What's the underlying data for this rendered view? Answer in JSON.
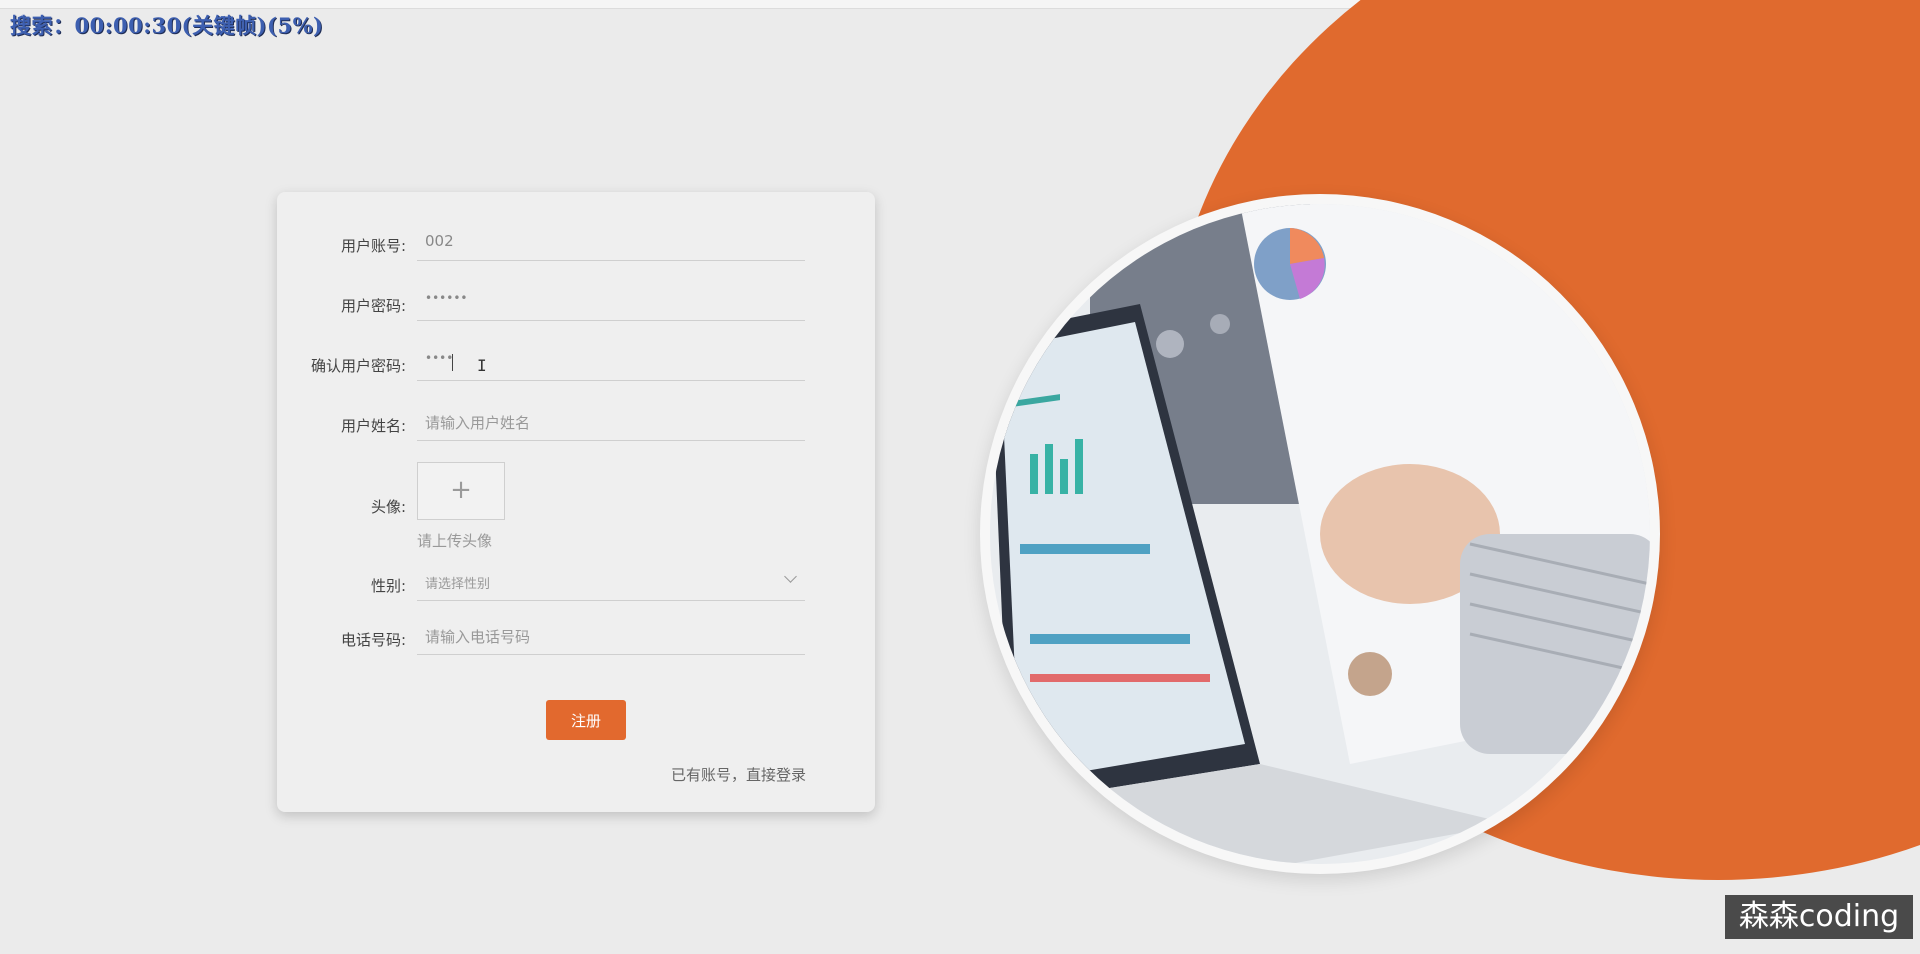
{
  "overlay": {
    "search_text": "搜索：00:00:30(关键帧)(5%)"
  },
  "form": {
    "account": {
      "label": "用户账号:",
      "value": "002"
    },
    "password": {
      "label": "用户密码:",
      "value": "••••••"
    },
    "confirm_password": {
      "label": "确认用户密码:",
      "value": "••••"
    },
    "name": {
      "label": "用户姓名:",
      "placeholder": "请输入用户姓名"
    },
    "avatar": {
      "label": "头像:",
      "hint": "请上传头像",
      "plus": "+"
    },
    "gender": {
      "label": "性别:",
      "placeholder": "请选择性别"
    },
    "phone": {
      "label": "电话号码:",
      "placeholder": "请输入电话号码"
    },
    "register_button": "注册",
    "login_link": "已有账号，直接登录"
  },
  "watermark": "森森coding",
  "colors": {
    "accent": "#e2692e",
    "background": "#ebebeb"
  }
}
